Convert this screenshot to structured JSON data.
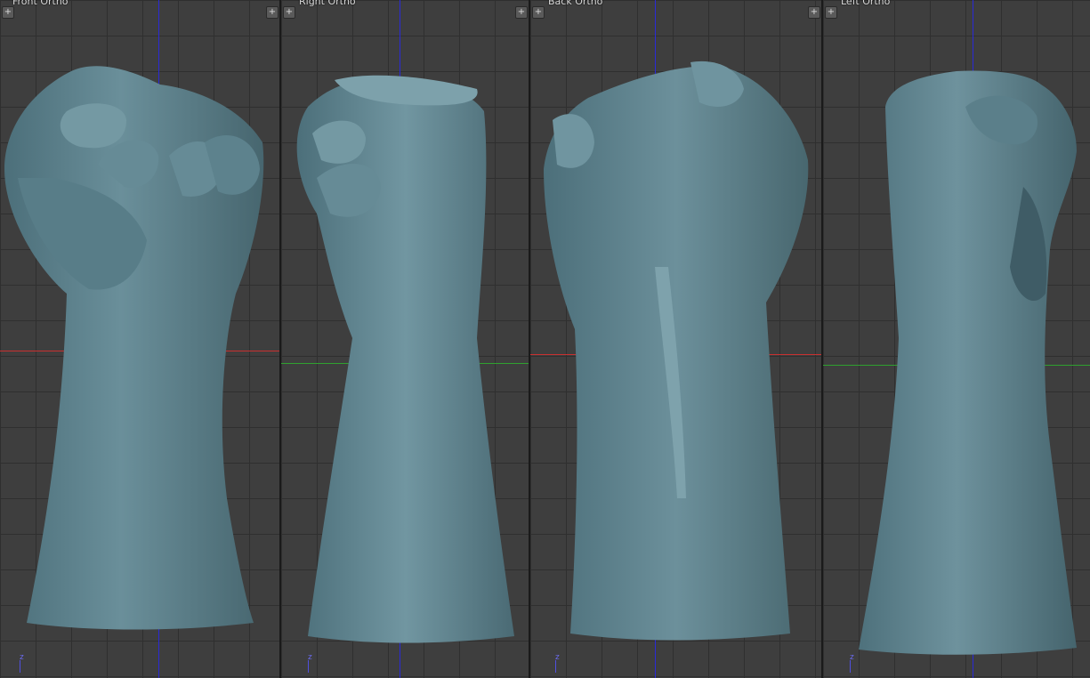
{
  "viewports": [
    {
      "label": "Front Ortho",
      "split_icon": "plus-icon",
      "horizontal_axis": "x",
      "axis_color": "#c83030",
      "gizmo_axis": "z"
    },
    {
      "label": "Right Ortho",
      "split_icon": "plus-icon",
      "horizontal_axis": "y",
      "axis_color": "#2fa02f",
      "gizmo_axis": "z"
    },
    {
      "label": "Back Ortho",
      "split_icon": "plus-icon",
      "horizontal_axis": "x",
      "axis_color": "#c83030",
      "gizmo_axis": "z"
    },
    {
      "label": "Left Ortho",
      "split_icon": "plus-icon",
      "horizontal_axis": "y",
      "axis_color": "#2fa02f",
      "gizmo_axis": "z"
    }
  ],
  "colors": {
    "viewport_bg": "#3e3e3e",
    "grid_line": "#2f2f2f",
    "vertical_axis": "#2a2ad8",
    "model_fill": "#5f8590",
    "model_highlight": "#86a8b2",
    "model_shadow": "#3f5c66"
  },
  "split_glyph": "+"
}
